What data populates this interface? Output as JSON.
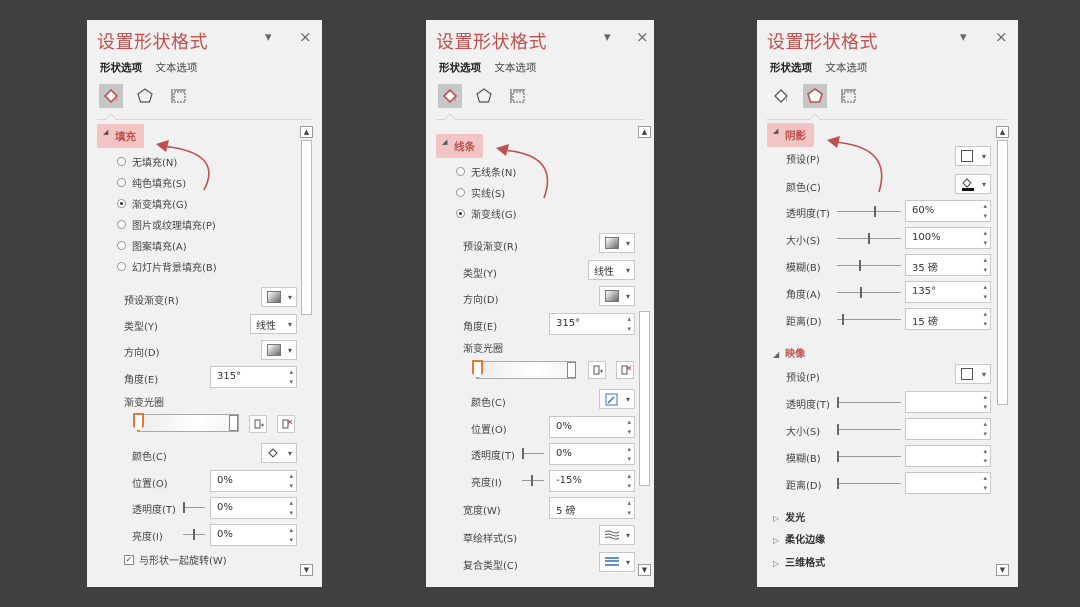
{
  "panel_title": "设置形状格式",
  "tab_shape": "形状选项",
  "tab_text": "文本选项",
  "close": "×",
  "dropdown": "▾",
  "p1": {
    "section": "填充",
    "radios": [
      "无填充(N)",
      "纯色填充(S)",
      "渐变填充(G)",
      "图片或纹理填充(P)",
      "图案填充(A)",
      "幻灯片背景填充(B)"
    ],
    "selected_radio": "渐变填充(G)",
    "preset_label": "预设渐变(R)",
    "type_label": "类型(Y)",
    "type_value": "线性",
    "direction_label": "方向(D)",
    "angle_label": "角度(E)",
    "angle_value": "315°",
    "stops_label": "渐变光圈",
    "color_label": "颜色(C)",
    "position_label": "位置(O)",
    "position_value": "0%",
    "transparency_label": "透明度(T)",
    "transparency_value": "0%",
    "brightness_label": "亮度(I)",
    "brightness_value": "0%",
    "rotate_label": "与形状一起旋转(W)"
  },
  "p2": {
    "section": "线条",
    "radios": [
      "无线条(N)",
      "实线(S)",
      "渐变线(G)"
    ],
    "selected_radio": "渐变线(G)",
    "preset_label": "预设渐变(R)",
    "type_label": "类型(Y)",
    "type_value": "线性",
    "direction_label": "方向(D)",
    "angle_label": "角度(E)",
    "angle_value": "315°",
    "stops_label": "渐变光圈",
    "color_label": "颜色(C)",
    "position_label": "位置(O)",
    "position_value": "0%",
    "transparency_label": "透明度(T)",
    "transparency_value": "0%",
    "brightness_label": "亮度(I)",
    "brightness_value": "-15%",
    "width_label": "宽度(W)",
    "width_value": "5 磅",
    "sketch_label": "草绘样式(S)",
    "compound_label": "复合类型(C)"
  },
  "p3": {
    "section": "阴影",
    "preset_label": "预设(P)",
    "color_label": "颜色(C)",
    "shadow_rows": [
      {
        "label": "透明度(T)",
        "value": "60%",
        "level": 0.6
      },
      {
        "label": "大小(S)",
        "value": "100%",
        "level": 0.5
      },
      {
        "label": "模糊(B)",
        "value": "35 磅",
        "level": 0.35
      },
      {
        "label": "角度(A)",
        "value": "135°",
        "level": 0.37
      },
      {
        "label": "距离(D)",
        "value": "15 磅",
        "level": 0.08
      }
    ],
    "reflection_title": "映像",
    "reflection_preset_label": "预设(P)",
    "reflection_rows": [
      "透明度(T)",
      "大小(S)",
      "模糊(B)",
      "距离(D)"
    ],
    "glow": "发光",
    "soft_edges": "柔化边缘",
    "three_d": "三维格式"
  },
  "colors": {
    "accent": "#c0504d",
    "section_bg": "#f3c4c4",
    "panel_bg": "#f1f1f1",
    "page_bg": "#404040"
  }
}
